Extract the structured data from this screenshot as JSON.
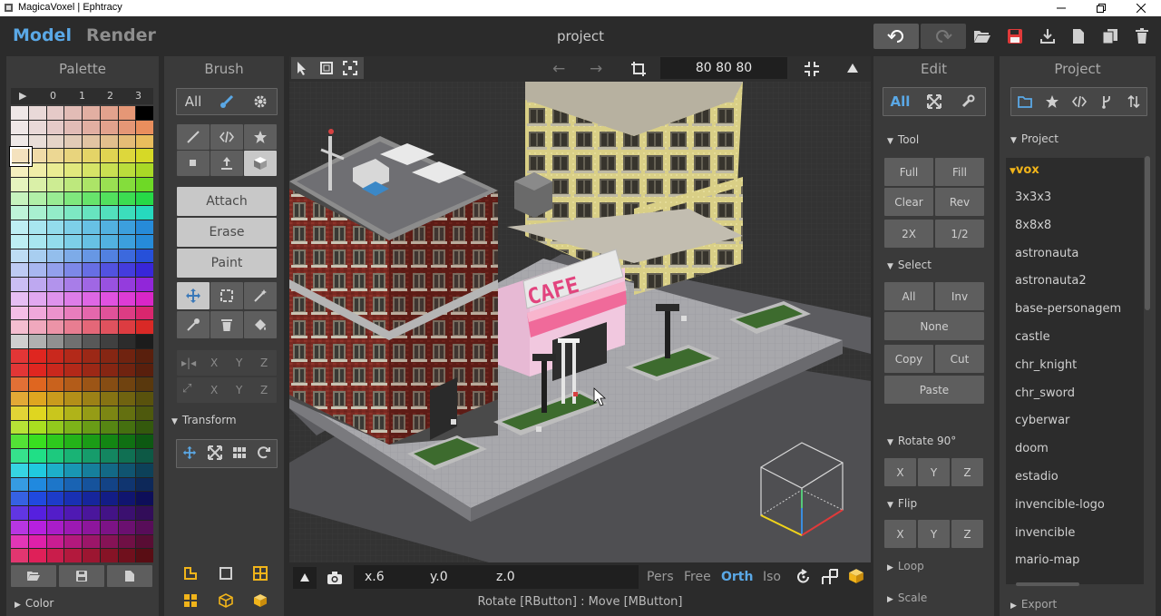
{
  "window": {
    "title": "MagicaVoxel | Ephtracy",
    "controls": [
      "minimize",
      "maximize",
      "close"
    ]
  },
  "app": {
    "mode_model": "Model",
    "mode_render": "Render",
    "project_title": "project",
    "accent": "#5aa8e6"
  },
  "palette": {
    "title": "Palette",
    "col_labels": [
      "0",
      "1",
      "2",
      "3"
    ],
    "footer_label": "Color"
  },
  "brush": {
    "title": "Brush",
    "filter_all": "All",
    "modes": [
      "Attach",
      "Erase",
      "Paint"
    ],
    "axis_x": "X",
    "axis_y": "Y",
    "axis_z": "Z",
    "transform_label": "Transform"
  },
  "viewport": {
    "dims": "80 80 80",
    "coord_x": "x.6",
    "coord_y": "y.0",
    "coord_z": "z.0",
    "views": [
      "Pers",
      "Free",
      "Orth",
      "Iso"
    ],
    "active_view": "Orth",
    "status": "Rotate [RButton] : Move [MButton]",
    "cafe_sign": "CAFE"
  },
  "edit": {
    "title": "Edit",
    "filter_all": "All",
    "tool_label": "Tool",
    "tool_buttons": [
      "Full",
      "Fill",
      "Clear",
      "Rev",
      "2X",
      "1/2"
    ],
    "select_label": "Select",
    "select_all": "All",
    "select_inv": "Inv",
    "select_none": "None",
    "select_copy": "Copy",
    "select_cut": "Cut",
    "select_paste": "Paste",
    "rotate_label": "Rotate 90°",
    "flip_label": "Flip",
    "axis_x": "X",
    "axis_y": "Y",
    "axis_z": "Z",
    "loop_label": "Loop",
    "scale_label": "Scale"
  },
  "project": {
    "title": "Project",
    "section_label": "Project",
    "folder": "vox",
    "items": [
      "3x3x3",
      "8x8x8",
      "astronauta",
      "astronauta2",
      "base-personagem",
      "castle",
      "chr_knight",
      "chr_sword",
      "cyberwar",
      "doom",
      "estadio",
      "invencible-logo",
      "invencible",
      "mario-map"
    ],
    "export_label": "Export"
  }
}
